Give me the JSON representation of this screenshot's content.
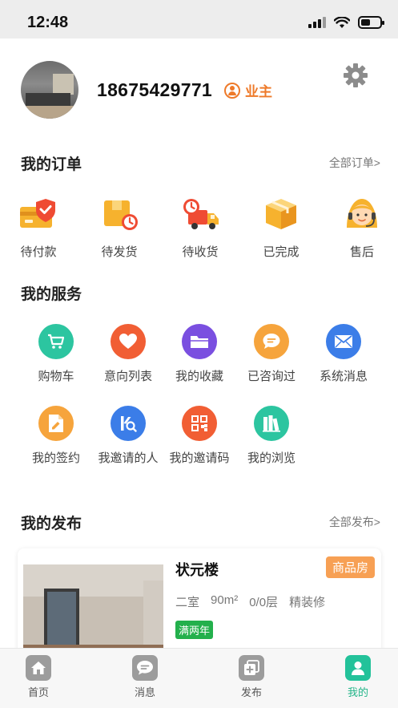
{
  "status_bar": {
    "time": "12:48"
  },
  "profile": {
    "phone": "18675429771",
    "role": "业主"
  },
  "orders": {
    "title": "我的订单",
    "more": "全部订单>",
    "items": [
      {
        "label": "待付款",
        "icon": "wallet-shield-icon"
      },
      {
        "label": "待发货",
        "icon": "package-clock-icon"
      },
      {
        "label": "待收货",
        "icon": "delivery-truck-icon"
      },
      {
        "label": "已完成",
        "icon": "open-box-icon"
      },
      {
        "label": "售后",
        "icon": "customer-service-icon"
      }
    ]
  },
  "services": {
    "title": "我的服务",
    "items": [
      {
        "label": "购物车",
        "icon": "shopping-cart-icon",
        "color": "#2cc5a0"
      },
      {
        "label": "意向列表",
        "icon": "heart-icon",
        "color": "#f15e34"
      },
      {
        "label": "我的收藏",
        "icon": "folder-icon",
        "color": "#7a4fe0"
      },
      {
        "label": "已咨询过",
        "icon": "chat-bubble-icon",
        "color": "#f6a43c"
      },
      {
        "label": "系统消息",
        "icon": "envelope-icon",
        "color": "#3b7de8"
      },
      {
        "label": "我的签约",
        "icon": "contract-icon",
        "color": "#f6a43c"
      },
      {
        "label": "我邀请的人",
        "icon": "invite-search-icon",
        "color": "#3b7de8"
      },
      {
        "label": "我的邀请码",
        "icon": "qr-code-icon",
        "color": "#f15e34"
      },
      {
        "label": "我的浏览",
        "icon": "books-icon",
        "color": "#2cc5a0"
      }
    ]
  },
  "publish": {
    "title": "我的发布",
    "more": "全部发布>",
    "listing": {
      "name": "状元楼",
      "type": "商品房",
      "rooms": "二室",
      "area": "90m²",
      "floor": "0/0层",
      "decor": "精装修",
      "tag": "满两年"
    }
  },
  "tabbar": {
    "items": [
      {
        "label": "首页",
        "icon": "home-icon"
      },
      {
        "label": "消息",
        "icon": "message-icon"
      },
      {
        "label": "发布",
        "icon": "publish-icon"
      },
      {
        "label": "我的",
        "icon": "profile-icon"
      }
    ],
    "active": "我的",
    "active_color": "#23c29a"
  }
}
